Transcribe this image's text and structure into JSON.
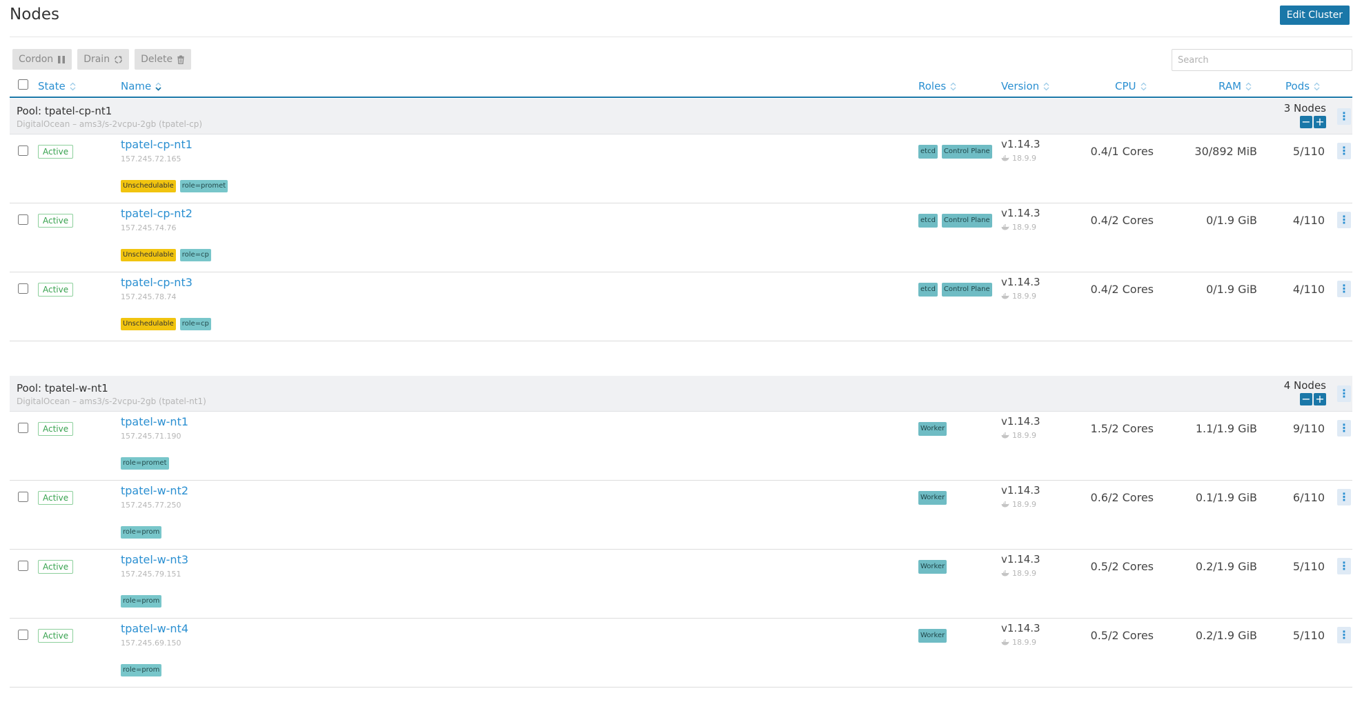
{
  "header": {
    "title": "Nodes",
    "edit_cluster_label": "Edit Cluster"
  },
  "toolbar": {
    "cordon_label": "Cordon",
    "drain_label": "Drain",
    "delete_label": "Delete"
  },
  "search": {
    "placeholder": "Search",
    "value": ""
  },
  "columns": {
    "state": "State",
    "name": "Name",
    "roles": "Roles",
    "version": "Version",
    "cpu": "CPU",
    "ram": "RAM",
    "pods": "Pods"
  },
  "pools": [
    {
      "title": "Pool: tpatel-cp-nt1",
      "subtitle": "DigitalOcean – ams3/s-2vcpu-2gb (tpatel-cp)",
      "count_label": "3 Nodes",
      "nodes": [
        {
          "state": "Active",
          "name": "tpatel-cp-nt1",
          "ip": "157.245.72.165",
          "unschedulable": "Unschedulable",
          "label": "role=promet",
          "roles": [
            "etcd",
            "Control Plane"
          ],
          "version": "v1.14.3",
          "docker": "18.9.9",
          "cpu": "0.4/1 Cores",
          "ram": "30/892 MiB",
          "pods": "5/110"
        },
        {
          "state": "Active",
          "name": "tpatel-cp-nt2",
          "ip": "157.245.74.76",
          "unschedulable": "Unschedulable",
          "label": "role=cp",
          "roles": [
            "etcd",
            "Control Plane"
          ],
          "version": "v1.14.3",
          "docker": "18.9.9",
          "cpu": "0.4/2 Cores",
          "ram": "0/1.9 GiB",
          "pods": "4/110"
        },
        {
          "state": "Active",
          "name": "tpatel-cp-nt3",
          "ip": "157.245.78.74",
          "unschedulable": "Unschedulable",
          "label": "role=cp",
          "roles": [
            "etcd",
            "Control Plane"
          ],
          "version": "v1.14.3",
          "docker": "18.9.9",
          "cpu": "0.4/2 Cores",
          "ram": "0/1.9 GiB",
          "pods": "4/110"
        }
      ]
    },
    {
      "title": "Pool: tpatel-w-nt1",
      "subtitle": "DigitalOcean – ams3/s-2vcpu-2gb (tpatel-nt1)",
      "count_label": "4 Nodes",
      "nodes": [
        {
          "state": "Active",
          "name": "tpatel-w-nt1",
          "ip": "157.245.71.190",
          "unschedulable": "",
          "label": "role=promet",
          "roles": [
            "Worker"
          ],
          "version": "v1.14.3",
          "docker": "18.9.9",
          "cpu": "1.5/2 Cores",
          "ram": "1.1/1.9 GiB",
          "pods": "9/110"
        },
        {
          "state": "Active",
          "name": "tpatel-w-nt2",
          "ip": "157.245.77.250",
          "unschedulable": "",
          "label": "role=prom",
          "roles": [
            "Worker"
          ],
          "version": "v1.14.3",
          "docker": "18.9.9",
          "cpu": "0.6/2 Cores",
          "ram": "0.1/1.9 GiB",
          "pods": "6/110"
        },
        {
          "state": "Active",
          "name": "tpatel-w-nt3",
          "ip": "157.245.79.151",
          "unschedulable": "",
          "label": "role=prom",
          "roles": [
            "Worker"
          ],
          "version": "v1.14.3",
          "docker": "18.9.9",
          "cpu": "0.5/2 Cores",
          "ram": "0.2/1.9 GiB",
          "pods": "5/110"
        },
        {
          "state": "Active",
          "name": "tpatel-w-nt4",
          "ip": "157.245.69.150",
          "unschedulable": "",
          "label": "role=prom",
          "roles": [
            "Worker"
          ],
          "version": "v1.14.3",
          "docker": "18.9.9",
          "cpu": "0.5/2 Cores",
          "ram": "0.2/1.9 GiB",
          "pods": "5/110"
        }
      ]
    }
  ],
  "colors": {
    "accent": "#1a77a8",
    "link": "#2a8fd1",
    "active": "#38a24f",
    "unschedulable": "#f1c40f",
    "label_tag": "#78c6ca",
    "role_tag": "#6fbcc4"
  },
  "icons": {
    "cordon": "pause-icon",
    "drain": "refresh-icon",
    "delete": "trash-icon",
    "sort": "sort-icon",
    "docker": "docker-whale-icon",
    "row_menu": "kebab-icon"
  }
}
